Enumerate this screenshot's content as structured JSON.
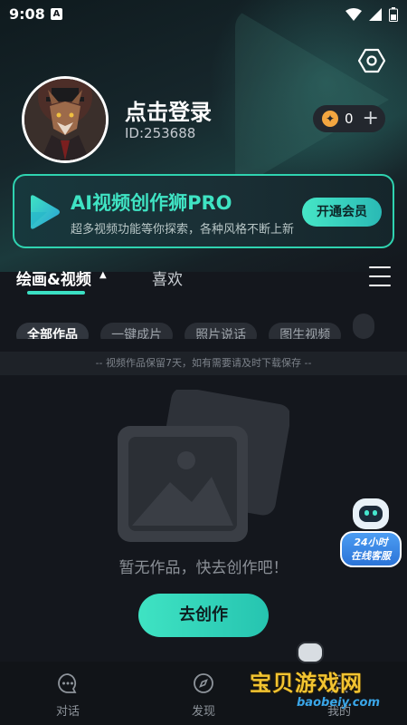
{
  "status_bar": {
    "time": "9:08",
    "app_badge": "A"
  },
  "profile": {
    "login_title": "点击登录",
    "user_id": "ID:253688",
    "coin_count": "0",
    "coin_plus": "+"
  },
  "pro_banner": {
    "title": "AI视频创作狮PRO",
    "subtitle": "超多视频功能等你探索，各种风格不断上新",
    "button_label": "开通会员"
  },
  "tabs": {
    "items": [
      {
        "label": "绘画&视频",
        "active": true
      },
      {
        "label": "喜欢",
        "active": false
      }
    ]
  },
  "filters": {
    "chips": [
      "全部作品",
      "一键成片",
      "照片说话",
      "图生视频",
      ""
    ]
  },
  "notice": "-- 视频作品保留7天，如有需要请及时下载保存 --",
  "empty_state": {
    "message": "暂无作品，快去创作吧！",
    "button_label": "去创作"
  },
  "support": {
    "line1": "24小时",
    "line2": "在线客服"
  },
  "bottom_nav": {
    "items": [
      {
        "label": "对话",
        "icon": "chat-icon"
      },
      {
        "label": "发现",
        "icon": "compass-icon"
      },
      {
        "label": "我的",
        "icon": "user-icon"
      }
    ]
  },
  "watermark": {
    "title": "宝贝游戏网",
    "url": "baobeiy.com"
  },
  "colors": {
    "accent": "#3fe3c3",
    "background": "#14171d",
    "chip_bg": "#2a2e35",
    "coin": "#f3a640"
  }
}
